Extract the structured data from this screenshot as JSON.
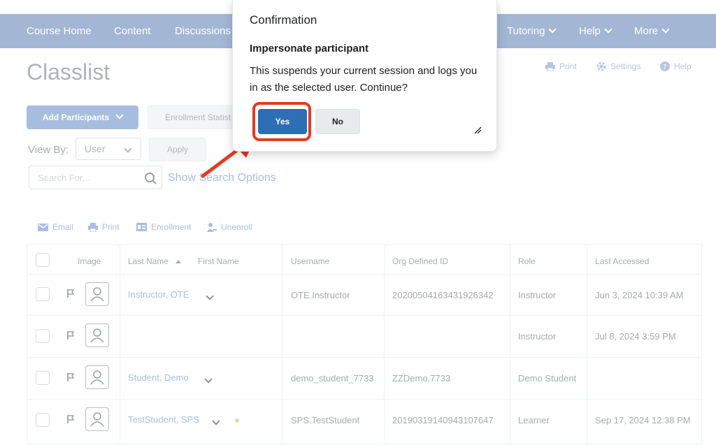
{
  "nav": {
    "items": [
      "Course Home",
      "Content",
      "Discussions",
      "Tutoring",
      "Help",
      "More"
    ]
  },
  "page": {
    "title": "Classlist",
    "print": "Print",
    "settings": "Settings",
    "help": "Help",
    "add_participants": "Add Participants",
    "enrollment_statistics": "Enrollment Statist",
    "view_by_label": "View By:",
    "view_by_value": "User",
    "apply": "Apply",
    "search_placeholder": "Search For...",
    "show_search_options": "Show Search Options"
  },
  "actions": {
    "email": "Email",
    "print": "Print",
    "enrollment": "Enrollment",
    "unenroll": "Unenroll"
  },
  "table": {
    "headers": [
      "Image",
      "Last Name",
      "First Name",
      "Username",
      "Org Defined ID",
      "Role",
      "Last Accessed"
    ],
    "rows": [
      {
        "name": "Instructor, OTE",
        "username": "OTE.Instructor",
        "org_id": "20200504163431926342",
        "role": "Instructor",
        "last_accessed": "Jun 3, 2024 10:39 AM"
      },
      {
        "name": "",
        "username": "",
        "org_id": "",
        "role": "Instructor",
        "last_accessed": "Jul 8, 2024 3:59 PM"
      },
      {
        "name": "Student, Demo",
        "username": "demo_student_7733",
        "org_id": "ZZDemo.7733",
        "role": "Demo Student",
        "last_accessed": ""
      },
      {
        "name": "TestStudent, SPS",
        "username": "SPS.TestStudent",
        "org_id": "20190319140943107647",
        "role": "Learner",
        "last_accessed": "Sep 17, 2024 12:38 PM"
      }
    ]
  },
  "dialog": {
    "title": "Confirmation",
    "subtitle": "Impersonate participant",
    "body": "This suspends your current session and logs you in as the selected user. Continue?",
    "yes": "Yes",
    "no": "No"
  },
  "colors": {
    "nav_bg": "#a3b6d4",
    "primary": "#2d6eb5",
    "highlight": "#e03b24"
  }
}
